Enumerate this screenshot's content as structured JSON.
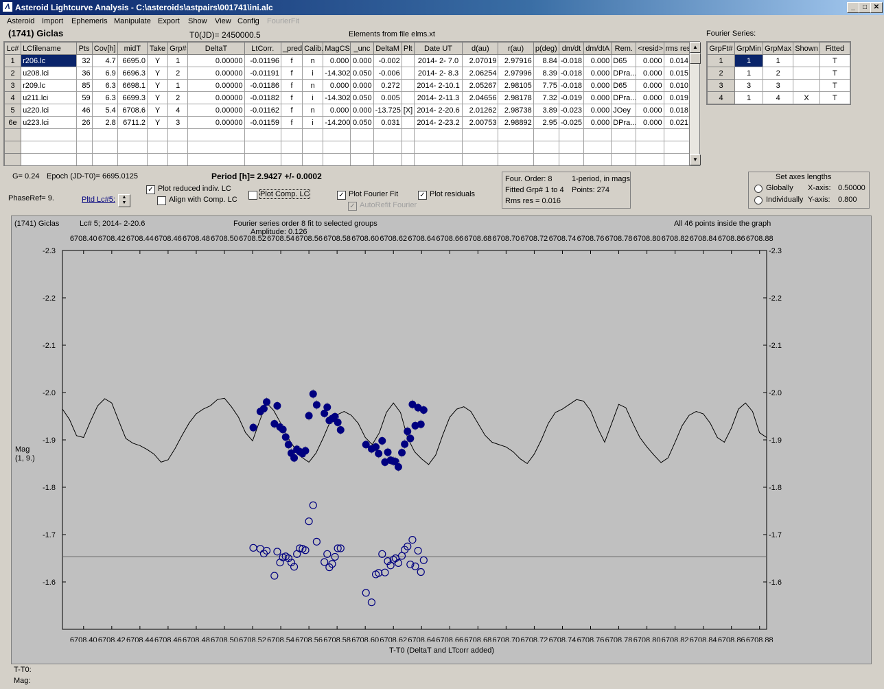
{
  "window": {
    "title": "Asteroid Lightcurve Analysis - C:\\asteroids\\astpairs\\001741\\ini.alc",
    "buttons": [
      "_",
      "□",
      "✕"
    ]
  },
  "menu": [
    "Asteroid",
    "Import",
    "Ephemeris",
    "Manipulate",
    "Export",
    "Show",
    "View",
    "Config"
  ],
  "menu_disabled": "FourierFit",
  "header": {
    "asteroid": "(1741) Giclas",
    "t0": "T0(JD)= 2450000.5",
    "elements": "Elements from file elms.xt"
  },
  "lc_table": {
    "columns": [
      "Lc#",
      "LCfilename",
      "Pts",
      "Cov[h]",
      "midT",
      "Take",
      "Grp#",
      "DeltaT",
      "LtCorr.",
      "_pred.",
      "Calib.",
      "MagCS",
      "_unc",
      "DeltaM",
      "Plt",
      "Date UT",
      "d(au)",
      "r(au)",
      "p(deg)",
      "dm/dt",
      "dm/dtA",
      "Rem.",
      "<resid>",
      "rms res"
    ],
    "rows": [
      [
        "1",
        "r206.lc",
        "32",
        "4.7",
        "6695.0",
        "Y",
        "1",
        "0.00000",
        "-0.01196",
        "f",
        "n",
        "0.000",
        "0.000",
        "-0.002",
        "",
        "2014- 2- 7.0",
        "2.07019",
        "2.97916",
        "8.84",
        "-0.018",
        "0.000",
        "D65",
        "0.000",
        "0.014"
      ],
      [
        "2",
        "u208.lci",
        "36",
        "6.9",
        "6696.3",
        "Y",
        "2",
        "0.00000",
        "-0.01191",
        "f",
        "i",
        "-14.302",
        "0.050",
        "-0.006",
        "",
        "2014- 2- 8.3",
        "2.06254",
        "2.97996",
        "8.39",
        "-0.018",
        "0.000",
        "DPra...",
        "0.000",
        "0.015"
      ],
      [
        "3",
        "r209.lc",
        "85",
        "6.3",
        "6698.1",
        "Y",
        "1",
        "0.00000",
        "-0.01186",
        "f",
        "n",
        "0.000",
        "0.000",
        "0.272",
        "",
        "2014- 2-10.1",
        "2.05267",
        "2.98105",
        "7.75",
        "-0.018",
        "0.000",
        "D65",
        "0.000",
        "0.010"
      ],
      [
        "4",
        "u211.lci",
        "59",
        "6.3",
        "6699.3",
        "Y",
        "2",
        "0.00000",
        "-0.01182",
        "f",
        "i",
        "-14.302",
        "0.050",
        "0.005",
        "",
        "2014- 2-11.3",
        "2.04656",
        "2.98178",
        "7.32",
        "-0.019",
        "0.000",
        "DPra...",
        "0.000",
        "0.019"
      ],
      [
        "5",
        "u220.lci",
        "46",
        "5.4",
        "6708.6",
        "Y",
        "4",
        "0.00000",
        "-0.01162",
        "f",
        "n",
        "0.000",
        "0.000",
        "-13.725",
        "[X]",
        "2014- 2-20.6",
        "2.01262",
        "2.98738",
        "3.89",
        "-0.023",
        "0.000",
        "JOey",
        "0.000",
        "0.018"
      ],
      [
        "6e",
        "u223.lci",
        "26",
        "2.8",
        "6711.2",
        "Y",
        "3",
        "0.00000",
        "-0.01159",
        "f",
        "i",
        "-14.200",
        "0.050",
        "0.031",
        "",
        "2014- 2-23.2",
        "2.00753",
        "2.98892",
        "2.95",
        "-0.025",
        "0.000",
        "DPra...",
        "0.000",
        "0.021"
      ]
    ]
  },
  "fourier_series": {
    "title": "Fourier Series:",
    "columns": [
      "GrpFt#",
      "GrpMin",
      "GrpMax",
      "Shown",
      "Fitted"
    ],
    "rows": [
      [
        "1",
        "1",
        "1",
        "",
        "T"
      ],
      [
        "2",
        "1",
        "2",
        "",
        "T"
      ],
      [
        "3",
        "3",
        "3",
        "",
        "T"
      ],
      [
        "4",
        "1",
        "4",
        "X",
        "T"
      ]
    ]
  },
  "controls": {
    "g": "G= 0.24",
    "epoch": "Epoch (JD-T0)= 6695.0125",
    "period": "Period [h]= 2.9427 +/- 0.0002",
    "phaseref": "PhaseRef= 9.",
    "pltd_lc": "Pltd Lc#5:",
    "plot_reduced": "Plot reduced indiv. LC",
    "align_comp": "Align with Comp. LC",
    "plot_comp": "Plot Comp. LC",
    "plot_fourier": "Plot Fourier Fit",
    "plot_residuals": "Plot residuals",
    "autorefit": "AutoRefit Fourier",
    "check_plot_reduced": true,
    "check_align_comp": false,
    "check_plot_comp": false,
    "check_plot_fourier": true,
    "check_plot_residuals": true,
    "check_autorefit": true
  },
  "fit_info": {
    "order": "Four. Order:  8",
    "period_mode": "1-period, in mags",
    "fitted_grp": "Fitted Grp# 1 to 4",
    "points": "Points: 274",
    "rms": "Rms res    = 0.016"
  },
  "axes_lengths": {
    "title": "Set axes lengths",
    "globally": "Globally",
    "individually": "Individually",
    "xaxis_label": "X-axis:",
    "xaxis_value": "0.50000",
    "yaxis_label": "Y-axis:",
    "yaxis_value": "0.800"
  },
  "plot_header": {
    "asteroid": "(1741) Giclas",
    "lc": "Lc# 5; 2014- 2-20.6",
    "fit": "Fourier series order 8 fit to selected groups",
    "amplitude": "Amplitude: 0.126",
    "inside": "All 46 points inside the graph",
    "ylabel_1": "Mag",
    "ylabel_2": "(1, 9.)",
    "xlabel": "T-T0 (DeltaT and LTcorr added)"
  },
  "status": {
    "t_t0": "T-T0:",
    "mag": "Mag:"
  },
  "chart_data": {
    "type": "scatter",
    "xlabel": "T-T0 (DeltaT and LTcorr added)",
    "ylabel": "Mag",
    "xlim": [
      6708.385,
      6708.885
    ],
    "ylim": [
      -2.3,
      -1.5
    ],
    "x_ticks": [
      6708.4,
      6708.42,
      6708.44,
      6708.46,
      6708.48,
      6708.5,
      6708.52,
      6708.54,
      6708.56,
      6708.58,
      6708.6,
      6708.62,
      6708.64,
      6708.66,
      6708.68,
      6708.7,
      6708.72,
      6708.74,
      6708.76,
      6708.78,
      6708.8,
      6708.82,
      6708.84,
      6708.86,
      6708.88
    ],
    "y_ticks": [
      -2.3,
      -2.2,
      -2.1,
      -2.0,
      -1.9,
      -1.8,
      -1.7,
      -1.6
    ],
    "residual_baseline": -1.653,
    "colors": {
      "points": "#000080",
      "fit": "#000000",
      "baseline": "#606060",
      "background": "#c0c0c0"
    },
    "observed": [
      [
        6708.5205,
        -1.926
      ],
      [
        6708.5255,
        -1.96
      ],
      [
        6708.528,
        -1.966
      ],
      [
        6708.53,
        -1.98
      ],
      [
        6708.5355,
        -1.934
      ],
      [
        6708.5375,
        -1.972
      ],
      [
        6708.5395,
        -1.927
      ],
      [
        6708.5415,
        -1.922
      ],
      [
        6708.5435,
        -1.906
      ],
      [
        6708.5455,
        -1.89
      ],
      [
        6708.5475,
        -1.872
      ],
      [
        6708.5495,
        -1.862
      ],
      [
        6708.5515,
        -1.88
      ],
      [
        6708.5535,
        -1.875
      ],
      [
        6708.5555,
        -1.871
      ],
      [
        6708.5575,
        -1.877
      ],
      [
        6708.56,
        -1.951
      ],
      [
        6708.563,
        -1.997
      ],
      [
        6708.5655,
        -1.974
      ],
      [
        6708.571,
        -1.956
      ],
      [
        6708.573,
        -1.969
      ],
      [
        6708.5745,
        -1.941
      ],
      [
        6708.5765,
        -1.945
      ],
      [
        6708.5785,
        -1.949
      ],
      [
        6708.5805,
        -1.937
      ],
      [
        6708.5825,
        -1.921
      ],
      [
        6708.6005,
        -1.89
      ],
      [
        6708.6045,
        -1.881
      ],
      [
        6708.6075,
        -1.885
      ],
      [
        6708.6095,
        -1.871
      ],
      [
        6708.612,
        -1.898
      ],
      [
        6708.614,
        -1.853
      ],
      [
        6708.616,
        -1.874
      ],
      [
        6708.618,
        -1.857
      ],
      [
        6708.62,
        -1.855
      ],
      [
        6708.6215,
        -1.854
      ],
      [
        6708.6235,
        -1.843
      ],
      [
        6708.626,
        -1.873
      ],
      [
        6708.628,
        -1.891
      ],
      [
        6708.63,
        -1.918
      ],
      [
        6708.632,
        -1.903
      ],
      [
        6708.6335,
        -1.975
      ],
      [
        6708.6355,
        -1.93
      ],
      [
        6708.6375,
        -1.968
      ],
      [
        6708.6395,
        -1.933
      ],
      [
        6708.6415,
        -1.963
      ]
    ],
    "residuals": [
      [
        6708.5205,
        -1.672
      ],
      [
        6708.5255,
        -1.67
      ],
      [
        6708.528,
        -1.66
      ],
      [
        6708.53,
        -1.666
      ],
      [
        6708.5355,
        -1.613
      ],
      [
        6708.5375,
        -1.664
      ],
      [
        6708.5395,
        -1.641
      ],
      [
        6708.5415,
        -1.652
      ],
      [
        6708.5435,
        -1.654
      ],
      [
        6708.5455,
        -1.65
      ],
      [
        6708.5475,
        -1.641
      ],
      [
        6708.5495,
        -1.632
      ],
      [
        6708.5515,
        -1.659
      ],
      [
        6708.5535,
        -1.671
      ],
      [
        6708.5555,
        -1.67
      ],
      [
        6708.5575,
        -1.667
      ],
      [
        6708.56,
        -1.728
      ],
      [
        6708.563,
        -1.762
      ],
      [
        6708.5655,
        -1.685
      ],
      [
        6708.571,
        -1.642
      ],
      [
        6708.573,
        -1.659
      ],
      [
        6708.5745,
        -1.631
      ],
      [
        6708.5765,
        -1.638
      ],
      [
        6708.5785,
        -1.653
      ],
      [
        6708.5805,
        -1.671
      ],
      [
        6708.5825,
        -1.671
      ],
      [
        6708.6005,
        -1.577
      ],
      [
        6708.6045,
        -1.557
      ],
      [
        6708.6075,
        -1.616
      ],
      [
        6708.6095,
        -1.619
      ],
      [
        6708.612,
        -1.659
      ],
      [
        6708.614,
        -1.62
      ],
      [
        6708.616,
        -1.644
      ],
      [
        6708.618,
        -1.635
      ],
      [
        6708.62,
        -1.647
      ],
      [
        6708.6215,
        -1.65
      ],
      [
        6708.6235,
        -1.64
      ],
      [
        6708.626,
        -1.655
      ],
      [
        6708.628,
        -1.668
      ],
      [
        6708.63,
        -1.675
      ],
      [
        6708.632,
        -1.637
      ],
      [
        6708.6335,
        -1.689
      ],
      [
        6708.6355,
        -1.633
      ],
      [
        6708.6375,
        -1.666
      ],
      [
        6708.6395,
        -1.621
      ],
      [
        6708.6415,
        -1.646
      ]
    ],
    "fit_curve": [
      [
        6708.385,
        -1.965
      ],
      [
        6708.39,
        -1.943
      ],
      [
        6708.395,
        -1.909
      ],
      [
        6708.4,
        -1.905
      ],
      [
        6708.405,
        -1.94
      ],
      [
        6708.41,
        -1.972
      ],
      [
        6708.415,
        -1.987
      ],
      [
        6708.42,
        -1.978
      ],
      [
        6708.425,
        -1.94
      ],
      [
        6708.43,
        -1.903
      ],
      [
        6708.435,
        -1.893
      ],
      [
        6708.44,
        -1.888
      ],
      [
        6708.445,
        -1.88
      ],
      [
        6708.45,
        -1.87
      ],
      [
        6708.455,
        -1.853
      ],
      [
        6708.46,
        -1.858
      ],
      [
        6708.465,
        -1.882
      ],
      [
        6708.47,
        -1.91
      ],
      [
        6708.475,
        -1.936
      ],
      [
        6708.48,
        -1.955
      ],
      [
        6708.485,
        -1.965
      ],
      [
        6708.49,
        -1.972
      ],
      [
        6708.495,
        -1.985
      ],
      [
        6708.5,
        -1.988
      ],
      [
        6708.505,
        -1.97
      ],
      [
        6708.51,
        -1.948
      ],
      [
        6708.515,
        -1.915
      ],
      [
        6708.52,
        -1.898
      ],
      [
        6708.525,
        -1.94
      ],
      [
        6708.53,
        -1.978
      ],
      [
        6708.535,
        -1.962
      ],
      [
        6708.54,
        -1.935
      ],
      [
        6708.545,
        -1.905
      ],
      [
        6708.55,
        -1.882
      ],
      [
        6708.555,
        -1.863
      ],
      [
        6708.56,
        -1.853
      ],
      [
        6708.565,
        -1.872
      ],
      [
        6708.57,
        -1.903
      ],
      [
        6708.575,
        -1.938
      ],
      [
        6708.58,
        -1.953
      ],
      [
        6708.585,
        -1.96
      ],
      [
        6708.59,
        -1.952
      ],
      [
        6708.595,
        -1.935
      ],
      [
        6708.6,
        -1.905
      ],
      [
        6708.605,
        -1.89
      ],
      [
        6708.61,
        -1.915
      ],
      [
        6708.615,
        -1.958
      ],
      [
        6708.62,
        -1.978
      ],
      [
        6708.625,
        -1.958
      ],
      [
        6708.63,
        -1.905
      ],
      [
        6708.635,
        -1.875
      ],
      [
        6708.64,
        -1.86
      ],
      [
        6708.645,
        -1.848
      ],
      [
        6708.65,
        -1.868
      ],
      [
        6708.655,
        -1.91
      ],
      [
        6708.66,
        -1.948
      ],
      [
        6708.665,
        -1.965
      ],
      [
        6708.67,
        -1.97
      ],
      [
        6708.675,
        -1.96
      ],
      [
        6708.68,
        -1.935
      ],
      [
        6708.685,
        -1.91
      ],
      [
        6708.69,
        -1.895
      ],
      [
        6708.695,
        -1.89
      ],
      [
        6708.7,
        -1.885
      ],
      [
        6708.705,
        -1.875
      ],
      [
        6708.71,
        -1.86
      ],
      [
        6708.715,
        -1.85
      ],
      [
        6708.72,
        -1.87
      ],
      [
        6708.725,
        -1.9
      ],
      [
        6708.73,
        -1.935
      ],
      [
        6708.735,
        -1.958
      ],
      [
        6708.74,
        -1.965
      ],
      [
        6708.745,
        -1.975
      ],
      [
        6708.75,
        -1.985
      ],
      [
        6708.755,
        -1.982
      ],
      [
        6708.76,
        -1.962
      ],
      [
        6708.765,
        -1.925
      ],
      [
        6708.77,
        -1.895
      ],
      [
        6708.775,
        -1.935
      ],
      [
        6708.78,
        -1.975
      ],
      [
        6708.785,
        -1.968
      ],
      [
        6708.79,
        -1.935
      ],
      [
        6708.795,
        -1.905
      ],
      [
        6708.8,
        -1.885
      ],
      [
        6708.805,
        -1.868
      ],
      [
        6708.81,
        -1.852
      ],
      [
        6708.815,
        -1.862
      ],
      [
        6708.82,
        -1.895
      ],
      [
        6708.825,
        -1.93
      ],
      [
        6708.83,
        -1.952
      ],
      [
        6708.835,
        -1.96
      ],
      [
        6708.84,
        -1.955
      ],
      [
        6708.845,
        -1.935
      ],
      [
        6708.85,
        -1.905
      ],
      [
        6708.855,
        -1.895
      ],
      [
        6708.86,
        -1.925
      ],
      [
        6708.865,
        -1.965
      ],
      [
        6708.87,
        -1.978
      ],
      [
        6708.875,
        -1.96
      ],
      [
        6708.88,
        -1.915
      ],
      [
        6708.885,
        -1.905
      ]
    ]
  }
}
